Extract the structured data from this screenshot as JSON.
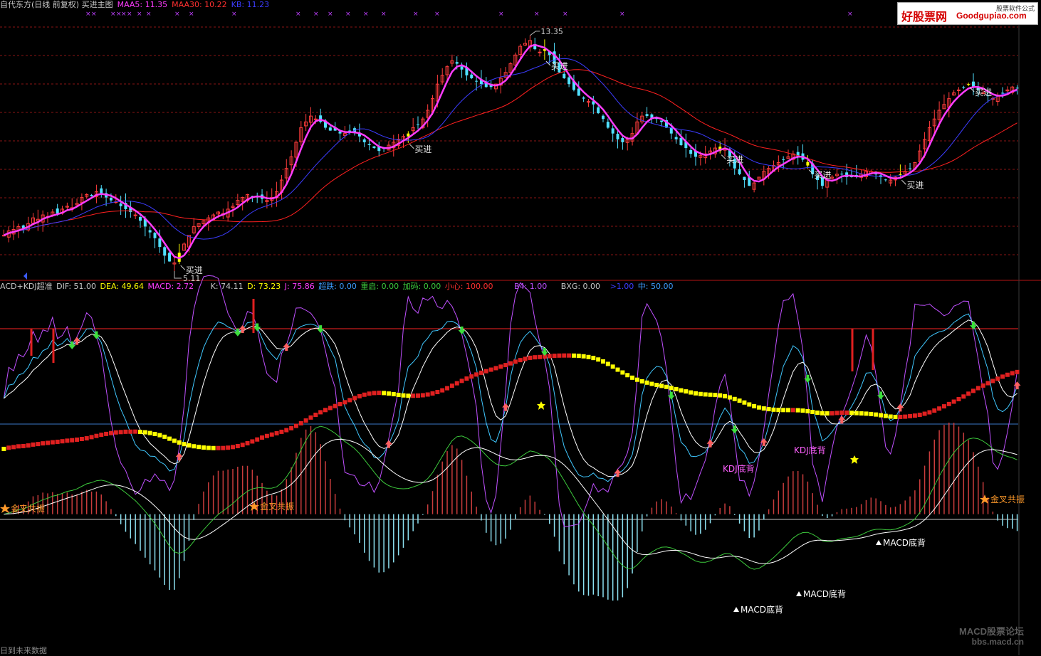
{
  "header": {
    "title": "自代东方(日线 前复权) 买进主图",
    "ma5": "MAA5: 11.35",
    "ma30": "MAA30: 10.22",
    "kb": "KB: 11.23"
  },
  "indicator_bar": {
    "name": "ACD+KDJ超准",
    "dif": "DIF: 51.00",
    "dea": "DEA: 49.64",
    "macd": "MACD: 2.72",
    "k": "K: 74.11",
    "d": "D: 73.23",
    "j": "J: 75.86",
    "chaodie": "超跌: 0.00",
    "chongqi": "重启: 0.00",
    "jiama": "加码: 0.00",
    "xiaoxin": "小心: 100.00",
    "b4": "B4: 1.00",
    "bxg": "BXG: 0.00",
    "g1": ">1.00",
    "zhong": "中: 50.00"
  },
  "logo": {
    "cn": "好股票网",
    "en": "Goodgupiao.com",
    "sub": "股票软件公式"
  },
  "watermark": {
    "line1": "MACD股票论坛",
    "line2": "bbs.macd.cn"
  },
  "footer": {
    "text": "日到未来数据"
  },
  "colors": {
    "up": "#ff3c3c",
    "down": "#50e0ff",
    "ma5": "#ff3cff",
    "ma30": "#ff2020",
    "kb": "#3c3cff",
    "yellow": "#ffff00",
    "grid": "#8a1414",
    "white": "#ffffff",
    "purple": "#c050ff",
    "green": "#3cc83c",
    "cyan": "#40c8ff"
  },
  "chart_data": [
    {
      "type": "candlestick",
      "name": "main",
      "ylim": [
        4.8,
        14.0
      ],
      "high_annotation": "13.35",
      "low_annotation": "5.11",
      "buy_label": "买进",
      "buy_signals": [
        36,
        83,
        111,
        147,
        165,
        184,
        198,
        224
      ],
      "close": [
        6.3,
        6.45,
        6.5,
        6.6,
        6.55,
        6.7,
        6.9,
        6.85,
        7.0,
        6.95,
        7.1,
        7.05,
        7.2,
        7.3,
        7.25,
        7.4,
        7.6,
        7.7,
        7.65,
        7.8,
        7.75,
        7.6,
        7.5,
        7.45,
        7.3,
        7.2,
        7.1,
        7.0,
        6.8,
        6.6,
        6.4,
        6.2,
        5.9,
        5.6,
        5.4,
        5.35,
        5.7,
        6.0,
        6.3,
        6.6,
        6.7,
        6.8,
        6.9,
        7.0,
        7.1,
        7.05,
        7.2,
        7.3,
        7.5,
        7.6,
        7.7,
        7.65,
        7.6,
        7.55,
        7.5,
        7.6,
        7.8,
        8.2,
        8.6,
        9.0,
        9.5,
        10.0,
        10.2,
        10.4,
        10.3,
        10.2,
        10.0,
        9.9,
        9.9,
        9.8,
        9.8,
        9.9,
        9.85,
        9.7,
        9.5,
        9.4,
        9.3,
        9.2,
        9.3,
        9.4,
        9.5,
        9.6,
        9.7,
        9.8,
        10.0,
        10.1,
        10.3,
        10.6,
        11.0,
        11.5,
        11.8,
        12.1,
        12.3,
        12.2,
        12.0,
        11.8,
        11.7,
        11.6,
        11.5,
        11.4,
        11.4,
        11.5,
        11.7,
        11.9,
        12.2,
        12.5,
        12.8,
        12.9,
        13.0,
        12.7,
        12.6,
        12.7,
        12.5,
        12.2,
        11.9,
        11.7,
        11.5,
        11.3,
        11.1,
        11.0,
        10.9,
        10.8,
        10.5,
        10.3,
        10.0,
        9.8,
        9.6,
        9.5,
        9.6,
        9.8,
        10.2,
        10.4,
        10.4,
        10.3,
        10.3,
        10.2,
        10.0,
        9.8,
        9.6,
        9.4,
        9.3,
        9.1,
        9.0,
        9.05,
        9.1,
        9.2,
        9.3,
        9.35,
        9.3,
        9.0,
        8.6,
        8.4,
        8.2,
        8.0,
        8.1,
        8.3,
        8.5,
        8.6,
        8.7,
        8.8,
        8.9,
        9.0,
        9.1,
        9.0,
        8.9,
        8.7,
        8.4,
        8.2,
        8.0,
        8.2,
        8.3,
        8.4,
        8.4,
        8.3,
        8.3,
        8.3,
        8.4,
        8.5,
        8.5,
        8.4,
        8.3,
        8.2,
        8.2,
        8.3,
        8.4,
        8.5,
        8.6,
        8.8,
        9.2,
        9.6,
        10.0,
        10.3,
        10.6,
        10.8,
        11.0,
        11.2,
        11.3,
        11.4,
        11.5,
        11.4,
        11.3,
        11.2,
        11.1,
        11.0,
        11.1,
        11.2,
        11.3,
        11.4,
        11.35
      ]
    },
    {
      "type": "line",
      "name": "indicator",
      "ylim": [
        -130,
        210
      ],
      "series": [
        "DIF",
        "DEA",
        "MACD",
        "K",
        "D",
        "J"
      ],
      "labels": {
        "golden_cross": "金叉共振",
        "kdj_divergence": "KDJ底背",
        "macd_divergence": "MACD底背"
      }
    }
  ]
}
